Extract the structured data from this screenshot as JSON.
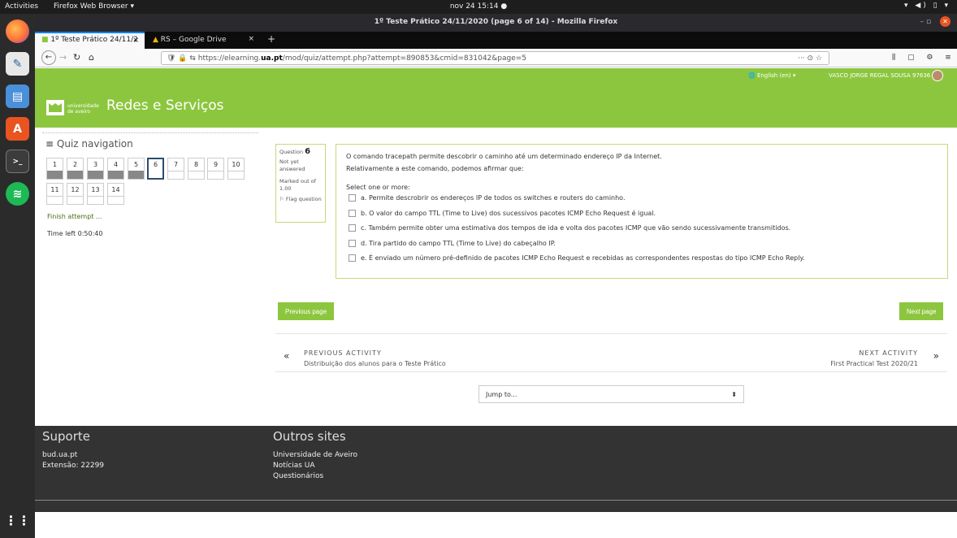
{
  "system": {
    "activities": "Activities",
    "app_menu": "Firefox Web Browser ▾",
    "clock": "nov 24  15:14 ●",
    "tray": "▾ ◀) ▯ ▾"
  },
  "window": {
    "title": "1º Teste Prático 24/11/2020 (page 6 of 14) - Mozilla Firefox",
    "controls": "–  ▫"
  },
  "tabs": [
    {
      "label": "1º Teste Prático 24/11/2",
      "close": "×"
    },
    {
      "label": "RS – Google Drive",
      "close": "×"
    }
  ],
  "newtab": "+",
  "toolbar": {
    "back": "←",
    "forward": "→",
    "reload": "↻",
    "home": "⌂",
    "url_prefix": "🛡 🔒 ⇆  https://elearning.",
    "url_domain": "ua.pt",
    "url_rest": "/mod/quiz/attempt.php?attempt=890853&cmid=831042&page=5",
    "url_actions": "··· ⊙ ☆",
    "right_icons": "⫼ ▢ ⚙ ≡"
  },
  "moodle": {
    "language": "🌐 English (en) ▾",
    "user": "VASCO JORGE REGAL SOUSA 97636",
    "logo_text_1": "universidade",
    "logo_text_2": "de aveiro",
    "course_title": "Redes e Serviços"
  },
  "quiz_nav": {
    "title": "Quiz navigation",
    "menu_icon": "≡",
    "buttons": [
      {
        "n": "1"
      },
      {
        "n": "2"
      },
      {
        "n": "3"
      },
      {
        "n": "4"
      },
      {
        "n": "5"
      },
      {
        "n": "6"
      },
      {
        "n": "7"
      },
      {
        "n": "8"
      },
      {
        "n": "9"
      },
      {
        "n": "10"
      },
      {
        "n": "11"
      },
      {
        "n": "12"
      },
      {
        "n": "13"
      },
      {
        "n": "14"
      }
    ],
    "finish": "Finish attempt ...",
    "time_label": "Time left ",
    "time_value": "0:50:40"
  },
  "question_info": {
    "label": "Question",
    "number": "6",
    "status": "Not yet answered",
    "marks": "Marked out of 1.00",
    "flag": "⚐ Flag question"
  },
  "question": {
    "line1": "O comando tracepath permite descobrir o caminho até um determinado endereço IP da Internet.",
    "line2": "Relativamente a este comando, podemos afirmar que:",
    "prompt": "Select one or more:",
    "options": [
      "a. Permite descrobrir os endereços IP de todos os switches e routers do caminho.",
      "b. O valor do campo TTL (Time to Live) dos sucessivos pacotes ICMP Echo Request é igual.",
      "c. Também permite obter uma estimativa dos tempos de ida e volta dos pacotes ICMP que vão sendo sucessivamente transmitidos.",
      "d. Tira partido do campo TTL (Time to Live) do cabeçalho IP.",
      "e. É enviado um número pré-definido de pacotes ICMP Echo Request e recebidas as correspondentes respostas do tipo ICMP Echo Reply."
    ]
  },
  "buttons": {
    "previous_page": "Previous page",
    "next_page": "Next page"
  },
  "activity_nav": {
    "prev_arrow": "«",
    "prev_label": "PREVIOUS ACTIVITY",
    "prev_name": "Distribuição dos alunos para o Teste Prático",
    "next_label": "NEXT ACTIVITY",
    "next_name": "First Practical Test 2020/21",
    "next_arrow": "»"
  },
  "jump": {
    "label": "Jump to...",
    "caret": "⬍"
  },
  "footer": {
    "support_title": "Suporte",
    "support_links": [
      "bud.ua.pt",
      "Extensão: 22299"
    ],
    "other_title": "Outros sites",
    "other_links": [
      "Universidade de Aveiro",
      "Notícias UA",
      "Questionários"
    ]
  },
  "colors": {
    "moodle_green": "#8cc63f",
    "footer_bg": "#333333"
  }
}
